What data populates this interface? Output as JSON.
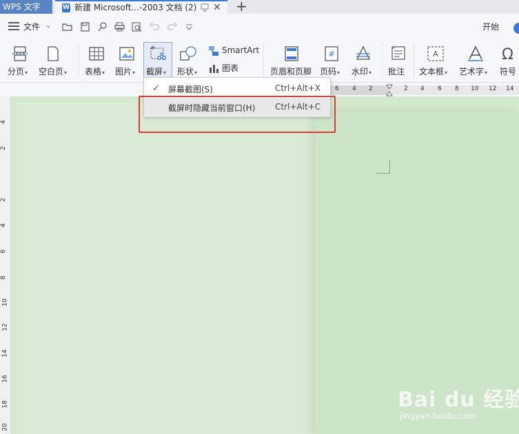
{
  "tabs": {
    "app_label": "WPS 文字",
    "document_title": "新建 Microsoft...-2003 文档 (2)",
    "new_tab_symbol": "+"
  },
  "quickbar": {
    "file_label": "文件",
    "start_label": "开始"
  },
  "ribbon": {
    "items": [
      {
        "label": "分页",
        "icon": "page-break-icon",
        "caret": true
      },
      {
        "label": "空白页",
        "icon": "blank-page-icon",
        "caret": true
      },
      {
        "label": "表格",
        "icon": "table-icon",
        "caret": true
      },
      {
        "label": "图片",
        "icon": "picture-icon",
        "caret": true
      },
      {
        "label": "截屏",
        "icon": "screenshot-icon",
        "caret": true
      },
      {
        "label": "形状",
        "icon": "shapes-icon",
        "caret": true
      },
      {
        "label": "SmartArt",
        "icon": "smartart-icon",
        "caret": false
      },
      {
        "label": "图表",
        "icon": "chart-icon",
        "caret": false
      },
      {
        "label": "页眉和页脚",
        "icon": "header-footer-icon",
        "caret": false
      },
      {
        "label": "页码",
        "icon": "page-number-icon",
        "caret": true
      },
      {
        "label": "水印",
        "icon": "watermark-icon",
        "caret": true
      },
      {
        "label": "批注",
        "icon": "comment-icon",
        "caret": false
      },
      {
        "label": "文本框",
        "icon": "textbox-icon",
        "caret": true
      },
      {
        "label": "艺术字",
        "icon": "wordart-icon",
        "caret": true
      },
      {
        "label": "符号",
        "icon": "symbol-icon",
        "caret": false
      }
    ],
    "caret_symbol": "▾"
  },
  "ruler": {
    "top_numbers": [
      "6",
      "4",
      "2",
      "2",
      "2",
      "4",
      "6",
      "8",
      "10",
      "12",
      "14"
    ],
    "left_numbers": [
      "4",
      "2",
      "2",
      "4",
      "6",
      "8",
      "10",
      "12",
      "14",
      "16",
      "18",
      "20"
    ]
  },
  "dropdown": {
    "items": [
      {
        "label": "屏幕截图(S)",
        "shortcut": "Ctrl+Alt+X",
        "checked": true
      },
      {
        "label": "截屏时隐藏当前窗口(H)",
        "shortcut": "Ctrl+Alt+C",
        "checked": false
      }
    ],
    "check_symbol": "✓"
  },
  "watermark": {
    "brand": "Bai du 经验",
    "url": "jingyan.baidu.com"
  },
  "colors": {
    "accent": "#3b78d8",
    "highlight_border": "#e23a2e",
    "document_background": "#cfe6c9"
  }
}
